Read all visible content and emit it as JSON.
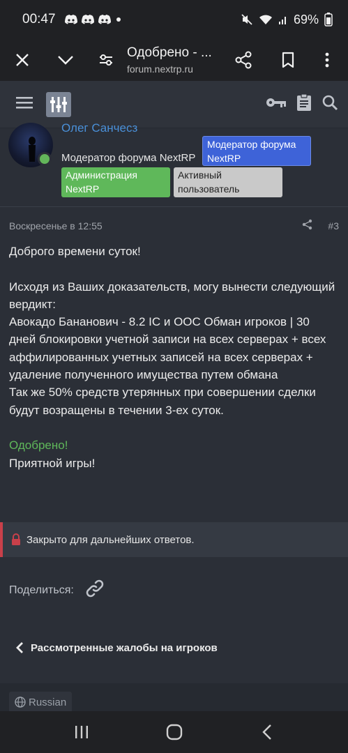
{
  "status": {
    "time": "00:47",
    "battery": "69%",
    "icons": [
      "discord-icon",
      "discord-icon",
      "discord-icon",
      "dot-icon",
      "mute-icon",
      "wifi-icon",
      "signal-icon",
      "battery-icon"
    ]
  },
  "browser": {
    "title": "Одобрено - ...",
    "url": "forum.nextrp.ru",
    "icons": [
      "close-icon",
      "chevron-down-icon",
      "page-info-icon",
      "share-icon",
      "bookmark-icon",
      "more-vert-icon"
    ]
  },
  "forum_header": {
    "icons": [
      "menu-icon",
      "logo-icon",
      "key-icon",
      "clipboard-icon",
      "search-icon"
    ]
  },
  "user": {
    "name": "Олег Санчесз",
    "title": "Модератор форума NextRP",
    "badges": [
      {
        "label": "Модератор форума NextRP",
        "color": "#3e63d8"
      },
      {
        "label": "Администрация NextRP",
        "color": "#5fb85a"
      },
      {
        "label": "Активный пользователь",
        "color": "#c9c9c9"
      }
    ],
    "online_color": "#63b65a"
  },
  "post": {
    "date": "Воскресенье в 12:55",
    "number": "#3",
    "lines": {
      "greeting": "Доброго времени суток!",
      "intro": "Исходя из Ваших доказательств, могу вынести следующий вердикт:",
      "verdict": "Авокадо Бананович - 8.2 IC и OOC Обман игроков | 30 дней блокировки учетной записи на всех серверах + всех аффилированных учетных записей на всех серверах + удаление полученного имущества путем обмана",
      "refund": "Так же 50% средств утерянных при совершении сделки будут возращены в течении 3-ех суток.",
      "approved": "Одобрено!",
      "closing": "Приятной игры!"
    },
    "approved_color": "#5fb85a"
  },
  "closed_notice": {
    "text": "Закрыто для дальнейших ответов.",
    "accent": "#c9404a"
  },
  "share": {
    "label": "Поделиться:"
  },
  "breadcrumb": {
    "label": "Рассмотренные жалобы на игроков"
  },
  "footer": {
    "language": "Russian"
  },
  "navbar": {
    "icons": [
      "recents-icon",
      "home-icon",
      "back-icon"
    ]
  }
}
